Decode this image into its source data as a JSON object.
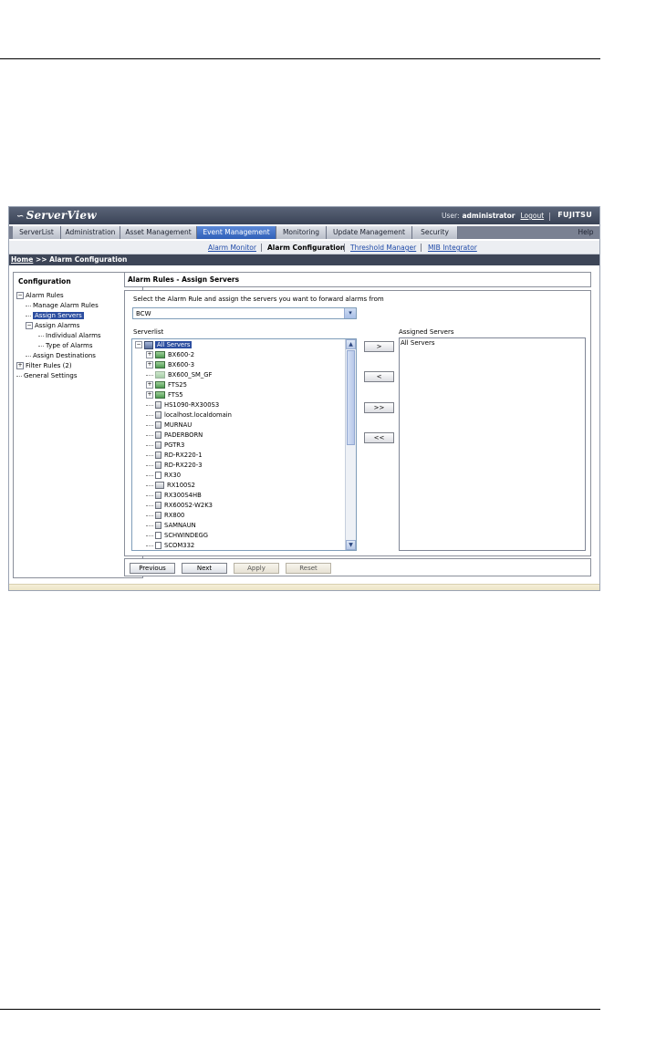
{
  "app": {
    "logo": "ServerView",
    "user_label": "User:",
    "user_name": "administrator",
    "logout": "Logout",
    "vendor": "FUJITSU"
  },
  "tabs": [
    "ServerList",
    "Administration",
    "Asset Management",
    "Event Management",
    "Monitoring",
    "Update Management",
    "Security"
  ],
  "active_tab": "Event Management",
  "help": "Help",
  "subnav": {
    "alarm_monitor": "Alarm Monitor",
    "alarm_configuration": "Alarm Configuration",
    "threshold_manager": "Threshold Manager",
    "mib_integrator": "MIB Integrator"
  },
  "breadcrumb": {
    "home": "Home",
    "rest": " >> Alarm Configuration"
  },
  "left_panel": {
    "title": "Configuration",
    "items": {
      "alarm_rules": "Alarm Rules",
      "manage_alarm_rules": "Manage Alarm Rules",
      "assign_servers": "Assign Servers",
      "assign_alarms": "Assign Alarms",
      "individual_alarms": "Individual Alarms",
      "type_of_alarms": "Type of Alarms",
      "assign_destinations": "Assign Destinations",
      "filter_rules": "Filter Rules (2)",
      "general_settings": "General Settings"
    }
  },
  "main": {
    "header": "Alarm Rules - Assign Servers",
    "instruction": "Select the Alarm Rule and assign the servers you want to forward alarms from",
    "rule_select_value": "BCW",
    "serverlist_label": "Serverlist",
    "assigned_label": "Assigned Servers",
    "serverlist": [
      "All Servers",
      "BX600-2",
      "BX600-3",
      "BX600_SM_GF",
      "FTS25",
      "FTS5",
      "HS1090-RX300S3",
      "localhost.localdomain",
      "MURNAU",
      "PADERBORN",
      "PGTR3",
      "RD-RX220-1",
      "RD-RX220-3",
      "RX30",
      "RX100S2",
      "RX300S4HB",
      "RX600S2-W2K3",
      "RX800",
      "SAMNAUN",
      "SCHWINDEGG",
      "SCOM332"
    ],
    "assigned": [
      "All Servers"
    ],
    "move_buttons": {
      "add": ">",
      "remove": "<",
      "add_all": ">>",
      "remove_all": "<<"
    }
  },
  "actions": {
    "previous": "Previous",
    "next": "Next",
    "apply": "Apply",
    "reset": "Reset"
  }
}
